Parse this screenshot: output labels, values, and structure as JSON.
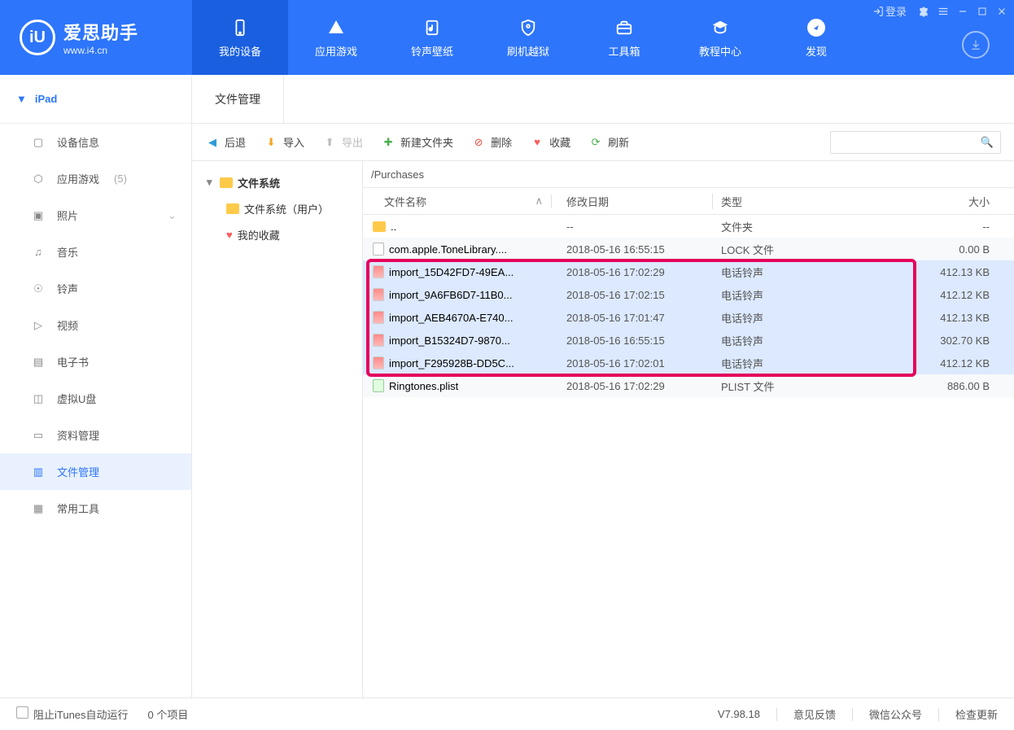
{
  "window": {
    "login_label": "登录"
  },
  "logo": {
    "title_cn": "爱思助手",
    "url": "www.i4.cn"
  },
  "nav": [
    {
      "label": "我的设备"
    },
    {
      "label": "应用游戏"
    },
    {
      "label": "铃声壁纸"
    },
    {
      "label": "刷机越狱"
    },
    {
      "label": "工具箱"
    },
    {
      "label": "教程中心"
    },
    {
      "label": "发现"
    }
  ],
  "device": {
    "name": "iPad"
  },
  "sidebar": [
    {
      "label": "设备信息"
    },
    {
      "label": "应用游戏",
      "count": "(5)"
    },
    {
      "label": "照片",
      "chevron": true
    },
    {
      "label": "音乐"
    },
    {
      "label": "铃声"
    },
    {
      "label": "视频"
    },
    {
      "label": "电子书"
    },
    {
      "label": "虚拟U盘"
    },
    {
      "label": "资料管理"
    },
    {
      "label": "文件管理"
    },
    {
      "label": "常用工具"
    }
  ],
  "subtab": {
    "label": "文件管理"
  },
  "toolbar": {
    "back": "后退",
    "import": "导入",
    "export": "导出",
    "new_folder": "新建文件夹",
    "delete": "删除",
    "favorite": "收藏",
    "refresh": "刷新"
  },
  "tree": {
    "root": "文件系统",
    "user": "文件系统（用户）",
    "fav": "我的收藏"
  },
  "path": "/Purchases",
  "columns": {
    "name": "文件名称",
    "date": "修改日期",
    "type": "类型",
    "size": "大小"
  },
  "files": [
    {
      "name": "..",
      "date": "--",
      "type": "文件夹",
      "size": "--",
      "icon": "folder"
    },
    {
      "name": "com.apple.ToneLibrary....",
      "date": "2018-05-16 16:55:15",
      "type": "LOCK 文件",
      "size": "0.00 B",
      "icon": "file"
    },
    {
      "name": "import_15D42FD7-49EA...",
      "date": "2018-05-16 17:02:29",
      "type": "电话铃声",
      "size": "412.13 KB",
      "icon": "music",
      "selected": true
    },
    {
      "name": "import_9A6FB6D7-11B0...",
      "date": "2018-05-16 17:02:15",
      "type": "电话铃声",
      "size": "412.12 KB",
      "icon": "music",
      "selected": true
    },
    {
      "name": "import_AEB4670A-E740...",
      "date": "2018-05-16 17:01:47",
      "type": "电话铃声",
      "size": "412.13 KB",
      "icon": "music",
      "selected": true
    },
    {
      "name": "import_B15324D7-9870...",
      "date": "2018-05-16 16:55:15",
      "type": "电话铃声",
      "size": "302.70 KB",
      "icon": "music",
      "selected": true
    },
    {
      "name": "import_F295928B-DD5C...",
      "date": "2018-05-16 17:02:01",
      "type": "电话铃声",
      "size": "412.12 KB",
      "icon": "music",
      "selected": true
    },
    {
      "name": "Ringtones.plist",
      "date": "2018-05-16 17:02:29",
      "type": "PLIST 文件",
      "size": "886.00 B",
      "icon": "plist"
    }
  ],
  "footer": {
    "block_itunes": "阻止iTunes自动运行",
    "item_count": "0 个项目",
    "version": "V7.98.18",
    "feedback": "意见反馈",
    "wechat": "微信公众号",
    "update": "检查更新"
  }
}
